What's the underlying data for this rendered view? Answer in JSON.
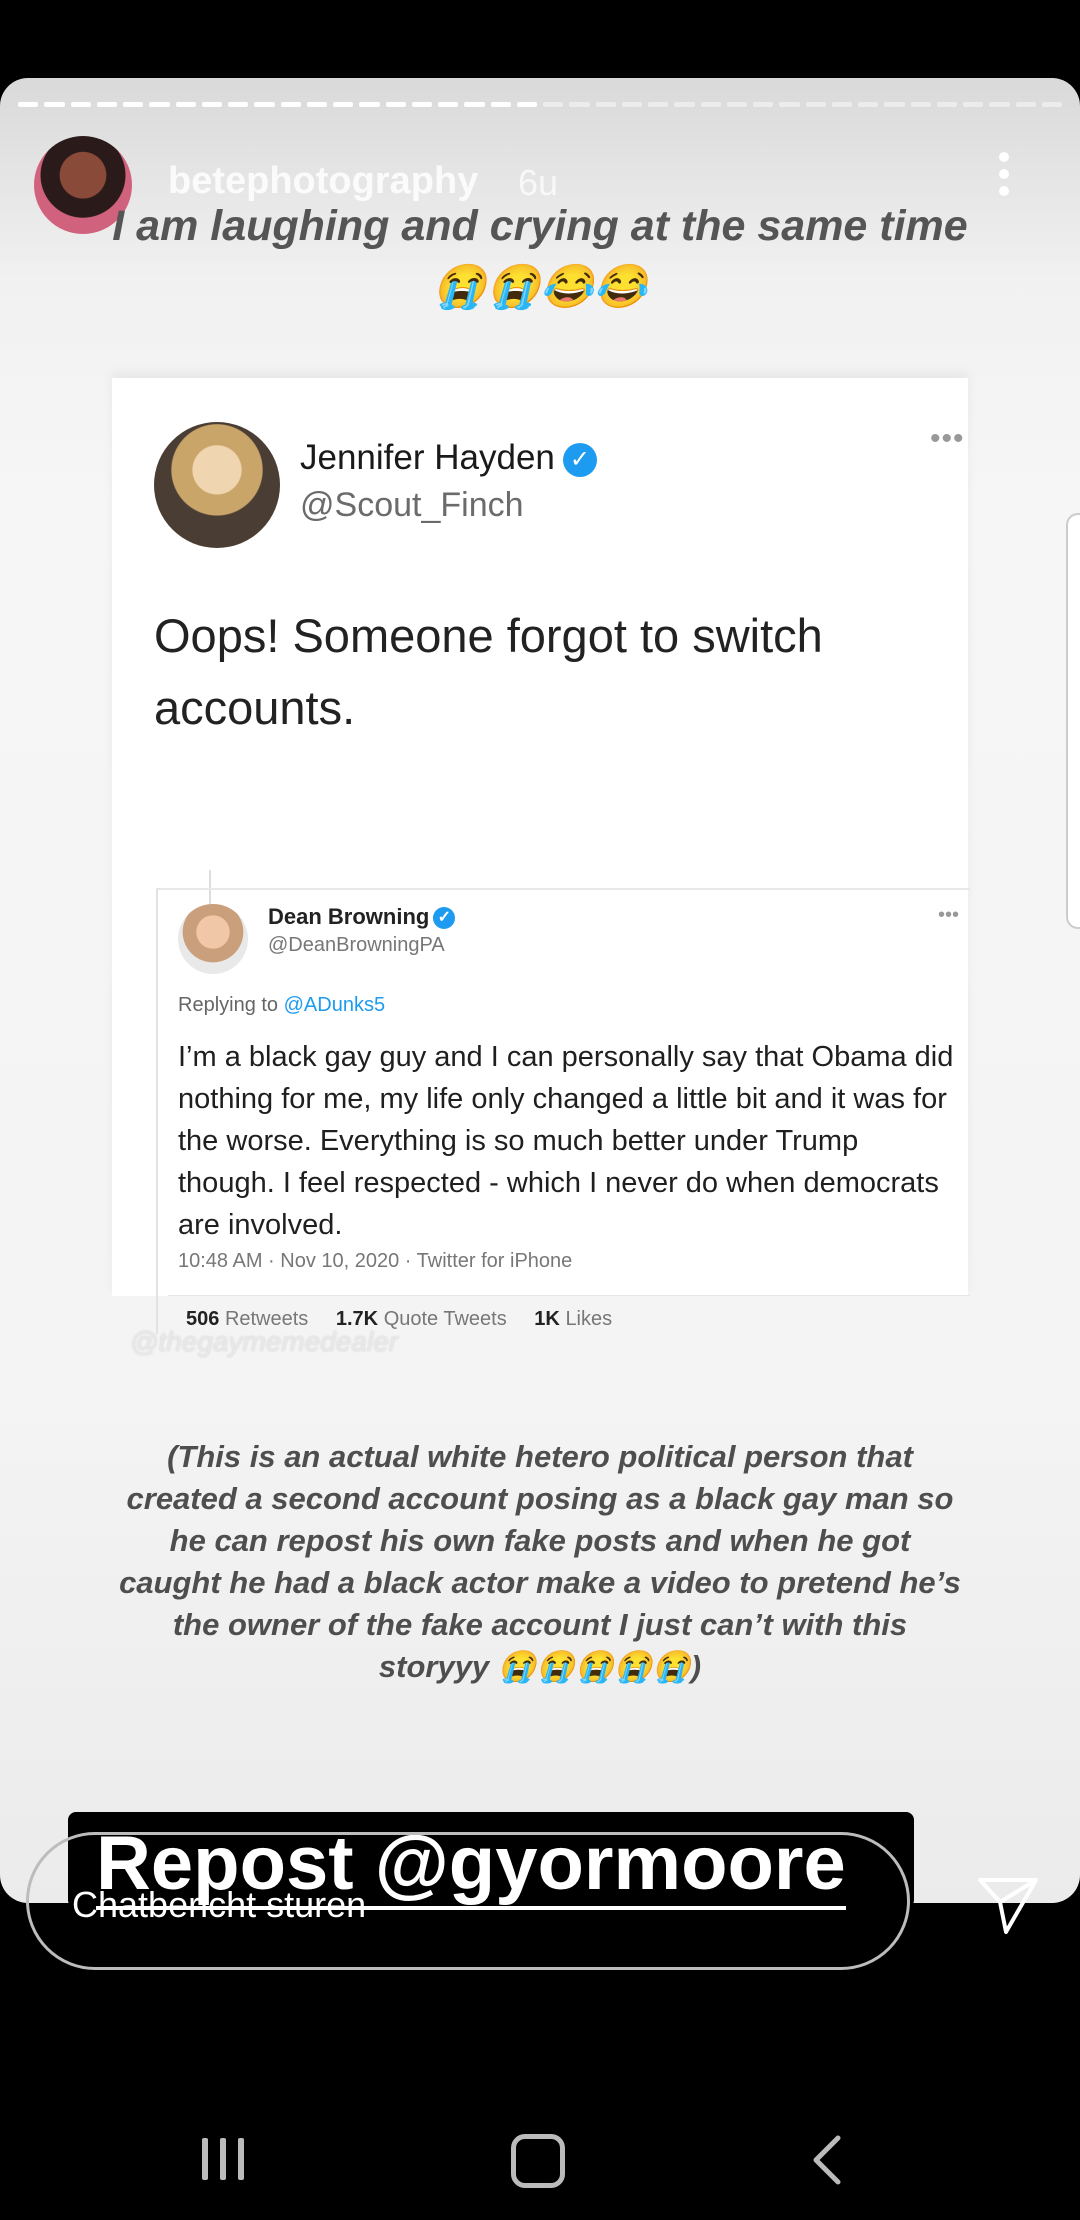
{
  "story": {
    "progress_segments_total": 40,
    "progress_segments_done": 20,
    "username": "betephotography",
    "time": "6u",
    "caption_top": "I am laughing and crying at the same time 😭😭😂😂",
    "caption_bottom": "(This is an actual white hetero political person that created a second account posing as a black gay man so he can repost his own fake posts and when he got caught he had a black actor make a video to pretend he’s the owner of the fake account I just can’t with this storyyy 😭😭😭😭😭)",
    "watermark": "@thegaymemedealer",
    "repost_label": "Repost @gyormoore"
  },
  "tweet": {
    "name": "Jennifer Hayden",
    "handle": "@Scout_Finch",
    "more": "•••",
    "text": "Oops! Someone forgot to switch accounts."
  },
  "quoted_tweet": {
    "name": "Dean Browning",
    "handle": "@DeanBrowningPA",
    "more": "•••",
    "replying_prefix": "Replying to ",
    "replying_to": "@ADunks5",
    "text": "I’m a black gay guy and I can personally say that Obama did nothing for me, my life only changed a little bit and it was for the worse. Everything is so much better under Trump though. I feel respected - which I never do when democrats are involved.",
    "meta": "10:48 AM · Nov 10, 2020 · Twitter for iPhone",
    "retweets_count": "506",
    "retweets_label": "Retweets",
    "quotes_count": "1.7K",
    "quotes_label": "Quote Tweets",
    "likes_count": "1K",
    "likes_label": "Likes"
  },
  "reply_bar": {
    "placeholder": "Chatbericht sturen"
  },
  "colors": {
    "verified": "#1d9bf0",
    "background": "#000000"
  },
  "icons": {
    "send": "send-icon",
    "more": "more-vertical-icon",
    "recent_apps": "recent-apps-icon",
    "home": "home-icon",
    "back": "back-icon"
  }
}
